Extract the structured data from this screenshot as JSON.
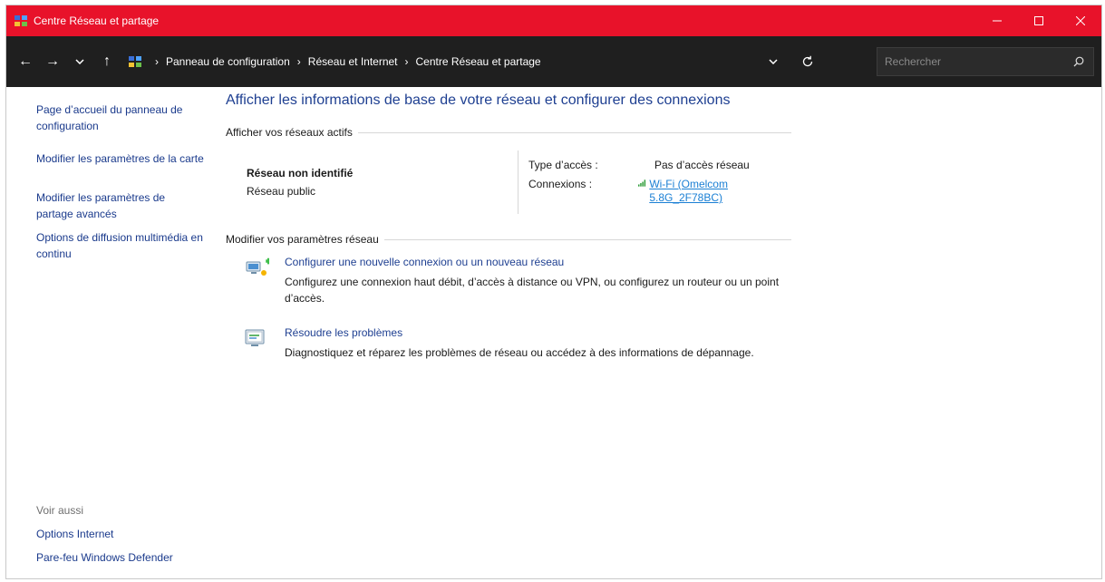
{
  "window": {
    "title": "Centre Réseau et partage",
    "controls": {
      "minimize": "—",
      "maximize": "☐",
      "close": "✕"
    }
  },
  "addressbar": {
    "nav": {
      "back": "←",
      "forward": "→",
      "recent": "⌄",
      "up": "↑"
    },
    "separator": "›",
    "breadcrumbs": [
      "Panneau de configuration",
      "Réseau et Internet",
      "Centre Réseau et partage"
    ],
    "dropdown_icon": "chevron-down-icon",
    "refresh_icon": "refresh-icon",
    "search_placeholder": "Rechercher"
  },
  "sidebar": {
    "links": [
      "Page d’accueil du panneau de configuration",
      "Modifier les paramètres de la carte",
      "Modifier les paramètres de partage avancés",
      "Options de diffusion multimédia en continu"
    ],
    "see_also_title": "Voir aussi",
    "see_also_links": [
      "Options Internet",
      "Pare-feu Windows Defender"
    ]
  },
  "main": {
    "heading": "Afficher les informations de base de votre réseau et configurer des connexions",
    "active_networks_label": "Afficher vos réseaux actifs",
    "network": {
      "name": "Réseau non identifié",
      "profile": "Réseau public",
      "access_type_label": "Type d’accès :",
      "access_type_value": "Pas d’accès réseau",
      "connections_label": "Connexions :",
      "connection_link": "Wi-Fi (Omelcom 5.8G_2F78BC)"
    },
    "change_settings_label": "Modifier vos paramètres réseau",
    "tasks": [
      {
        "icon": "new-connection-icon",
        "link": "Configurer une nouvelle connexion ou un nouveau réseau",
        "description": "Configurez une connexion haut débit, d’accès à distance ou VPN, ou configurez un routeur ou un point d’accès."
      },
      {
        "icon": "troubleshoot-icon",
        "link": "Résoudre les problèmes",
        "description": "Diagnostiquez et réparez les problèmes de réseau ou accédez à des informations de dépannage."
      }
    ]
  },
  "colors": {
    "titlebar": "#e8122a",
    "addressbar": "#1f1f1f",
    "link": "#1a3a8c",
    "heading": "#1e3f91",
    "hyperlink": "#1a7fd4"
  }
}
